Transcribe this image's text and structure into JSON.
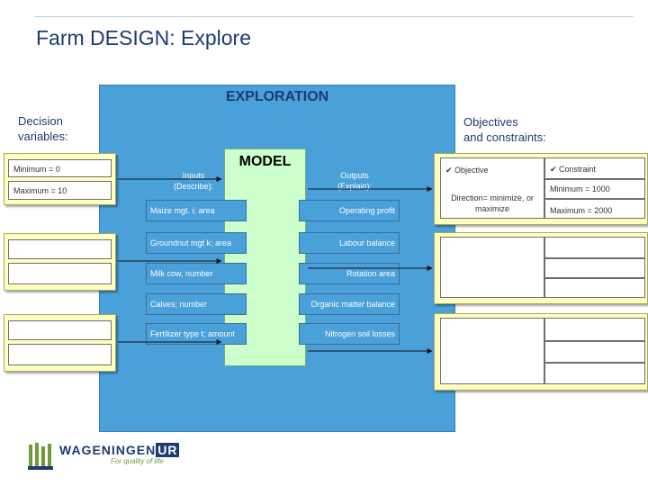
{
  "slide": {
    "title": "Farm DESIGN: Explore"
  },
  "exploration": {
    "title": "EXPLORATION"
  },
  "model": {
    "title": "MODEL"
  },
  "decision_variables": {
    "label_line1": "Decision",
    "label_line2": "variables:",
    "minimum": "Minimum = 0",
    "maximum": "Maximum = 10"
  },
  "objectives": {
    "label_line1": "Objectives",
    "label_line2": "and constraints:",
    "objective_header": "✔ Objective",
    "constraint_header": "✔ Constraint",
    "direction_line1": "Direction= minimize, or",
    "direction_line2": "maximize",
    "minimum": "Minimum = 1000",
    "maximum": "Maximum = 2000"
  },
  "inputs": {
    "label_line1": "Inputs",
    "label_line2": "(Describe):",
    "items": [
      "Maize mgt. i; area",
      "Groundnut mgt k; area",
      "Milk cow, number",
      "Calves; number",
      "Fertilizer type t; amount"
    ]
  },
  "outputs": {
    "label_line1": "Outputs",
    "label_line2": "(Explain):",
    "items": [
      "Operating profit",
      "Labour balance",
      "Rotation area",
      "Organic matter balance",
      "Nitrogen soil losses"
    ]
  },
  "logo": {
    "wordmark": "WAGENINGEN",
    "wordmark_suffix": "UR",
    "tagline": "For quality of life"
  },
  "colors": {
    "exploration_bg": "#4aa0d8",
    "model_bg": "#ccffcc",
    "card_bg": "#ffffc0",
    "title_text": "#1d3b73"
  }
}
